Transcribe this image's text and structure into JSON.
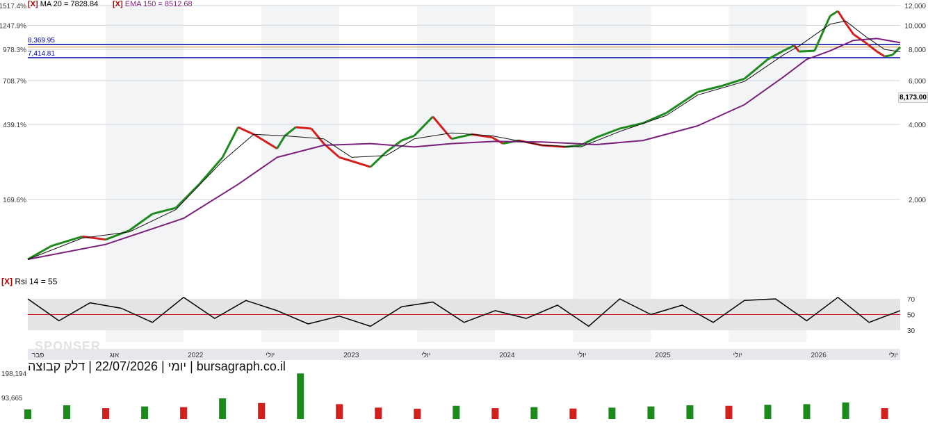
{
  "indicators": {
    "x_mark": "[X]",
    "ma": "MA 20 = 7828.84",
    "ema": "EMA 150 = 8512.68",
    "rsi": "Rsi 14 = 55"
  },
  "caption": "יומי | 22/07/2026 | דלק קבוצה | bursagraph.co.il",
  "watermark": "SPONSER",
  "last_price": "8,173.00",
  "chart_data": [
    {
      "type": "line",
      "name": "price",
      "y_scale": "log",
      "ylim": [
        1100,
        12000
      ],
      "y_ticks_right": [
        "12,000",
        "10,000",
        "8,000",
        "6,000",
        "4,000",
        "2,000"
      ],
      "y_tick_values_right": [
        12000,
        10000,
        8000,
        6000,
        4000,
        2000
      ],
      "y_ticks_left": [
        "1517.4%",
        "1247.9%",
        "978.3%",
        "708.7%",
        "439.1%",
        "169.6%"
      ],
      "grid": true,
      "x_labels": [
        "פבר",
        "אוג",
        "2022",
        "יולי",
        "2023",
        "יולי",
        "2024",
        "יולי",
        "2025",
        "יולי",
        "2026",
        "יולי"
      ],
      "x_label_positions": [
        0.0,
        0.5,
        1.0,
        1.5,
        2.0,
        2.5,
        3.0,
        3.5,
        4.0,
        4.5,
        5.0,
        5.5
      ],
      "horizontal_lines": [
        {
          "label": "8,369.95",
          "value": 8369.95,
          "color": "#0000aa"
        },
        {
          "label": "7,414.81",
          "value": 7414.81,
          "color": "#0000aa"
        }
      ],
      "last_price": 8173,
      "close_series": {
        "x": [
          0.0,
          0.15,
          0.35,
          0.5,
          0.65,
          0.8,
          0.95,
          1.1,
          1.25,
          1.35,
          1.45,
          1.6,
          1.65,
          1.72,
          1.82,
          1.9,
          2.0,
          2.08,
          2.2,
          2.3,
          2.4,
          2.48,
          2.6,
          2.72,
          2.85,
          2.98,
          3.05,
          3.15,
          3.3,
          3.45,
          3.55,
          3.65,
          3.8,
          3.95,
          4.1,
          4.2,
          4.3,
          4.45,
          4.6,
          4.75,
          4.85,
          4.92,
          4.95,
          5.05,
          5.15,
          5.2,
          5.25,
          5.3,
          5.38,
          5.45,
          5.5,
          5.55,
          5.6
        ],
        "close": [
          1150,
          1300,
          1420,
          1380,
          1500,
          1750,
          1850,
          2300,
          2950,
          3900,
          3650,
          3200,
          3600,
          3900,
          3850,
          3350,
          2950,
          2850,
          2700,
          3100,
          3450,
          3600,
          4300,
          3500,
          3650,
          3550,
          3350,
          3450,
          3300,
          3250,
          3300,
          3550,
          3850,
          4050,
          4450,
          4900,
          5400,
          5700,
          6100,
          7300,
          7900,
          8300,
          7850,
          7900,
          10900,
          11400,
          10200,
          9200,
          8500,
          7850,
          7500,
          7600,
          8173
        ]
      },
      "ma20_series": {
        "x": [
          0.0,
          0.35,
          0.65,
          0.95,
          1.25,
          1.45,
          1.65,
          1.9,
          2.08,
          2.3,
          2.48,
          2.72,
          2.98,
          3.3,
          3.55,
          3.8,
          4.1,
          4.3,
          4.6,
          4.85,
          4.95,
          5.15,
          5.25,
          5.38,
          5.5,
          5.6
        ],
        "values": [
          1150,
          1400,
          1480,
          1820,
          2850,
          3650,
          3600,
          3500,
          2950,
          3000,
          3500,
          3700,
          3600,
          3300,
          3250,
          3750,
          4350,
          5250,
          5950,
          7600,
          8250,
          10100,
          10400,
          9000,
          8000,
          7830
        ]
      },
      "ema150": {
        "name": "EMA 150",
        "last": 8512.68
      },
      "ema150_series": {
        "x": [
          0.0,
          0.5,
          1.0,
          1.35,
          1.6,
          1.9,
          2.2,
          2.48,
          2.72,
          3.0,
          3.3,
          3.65,
          3.95,
          4.3,
          4.6,
          4.85,
          5.0,
          5.15,
          5.3,
          5.45,
          5.6
        ],
        "values": [
          1150,
          1320,
          1680,
          2300,
          2950,
          3300,
          3350,
          3250,
          3350,
          3420,
          3400,
          3320,
          3450,
          3950,
          4800,
          6200,
          7300,
          7900,
          8700,
          8850,
          8513
        ]
      }
    },
    {
      "type": "line",
      "name": "Rsi 14",
      "ylim": [
        0,
        100
      ],
      "y_ticks": [
        "70",
        "50",
        "30"
      ],
      "y_tick_values": [
        70,
        50,
        30
      ],
      "band": [
        30,
        70
      ],
      "midline": 50,
      "last": 55,
      "x": [
        0.0,
        0.2,
        0.4,
        0.6,
        0.8,
        1.0,
        1.2,
        1.4,
        1.6,
        1.8,
        2.0,
        2.2,
        2.4,
        2.6,
        2.8,
        3.0,
        3.2,
        3.4,
        3.6,
        3.8,
        4.0,
        4.2,
        4.4,
        4.6,
        4.8,
        5.0,
        5.2,
        5.4,
        5.6
      ],
      "values": [
        70,
        42,
        65,
        58,
        40,
        72,
        45,
        68,
        55,
        38,
        48,
        35,
        60,
        66,
        40,
        55,
        45,
        62,
        35,
        70,
        50,
        62,
        40,
        68,
        70,
        42,
        72,
        40,
        55
      ]
    },
    {
      "type": "bar",
      "name": "volume",
      "ylim": [
        0,
        220000
      ],
      "y_ticks": [
        "198,194",
        "93,665"
      ],
      "y_tick_values": [
        198194,
        93665
      ],
      "x": [
        0.0,
        0.25,
        0.5,
        0.75,
        1.0,
        1.25,
        1.5,
        1.75,
        2.0,
        2.25,
        2.5,
        2.75,
        3.0,
        3.25,
        3.5,
        3.75,
        4.0,
        4.25,
        4.5,
        4.75,
        5.0,
        5.25,
        5.5
      ],
      "values": [
        42000,
        60000,
        48000,
        55000,
        52000,
        90000,
        70000,
        198194,
        65000,
        50000,
        45000,
        58000,
        48000,
        52000,
        46000,
        50000,
        55000,
        60000,
        58000,
        62000,
        65000,
        72000,
        48000
      ]
    }
  ]
}
